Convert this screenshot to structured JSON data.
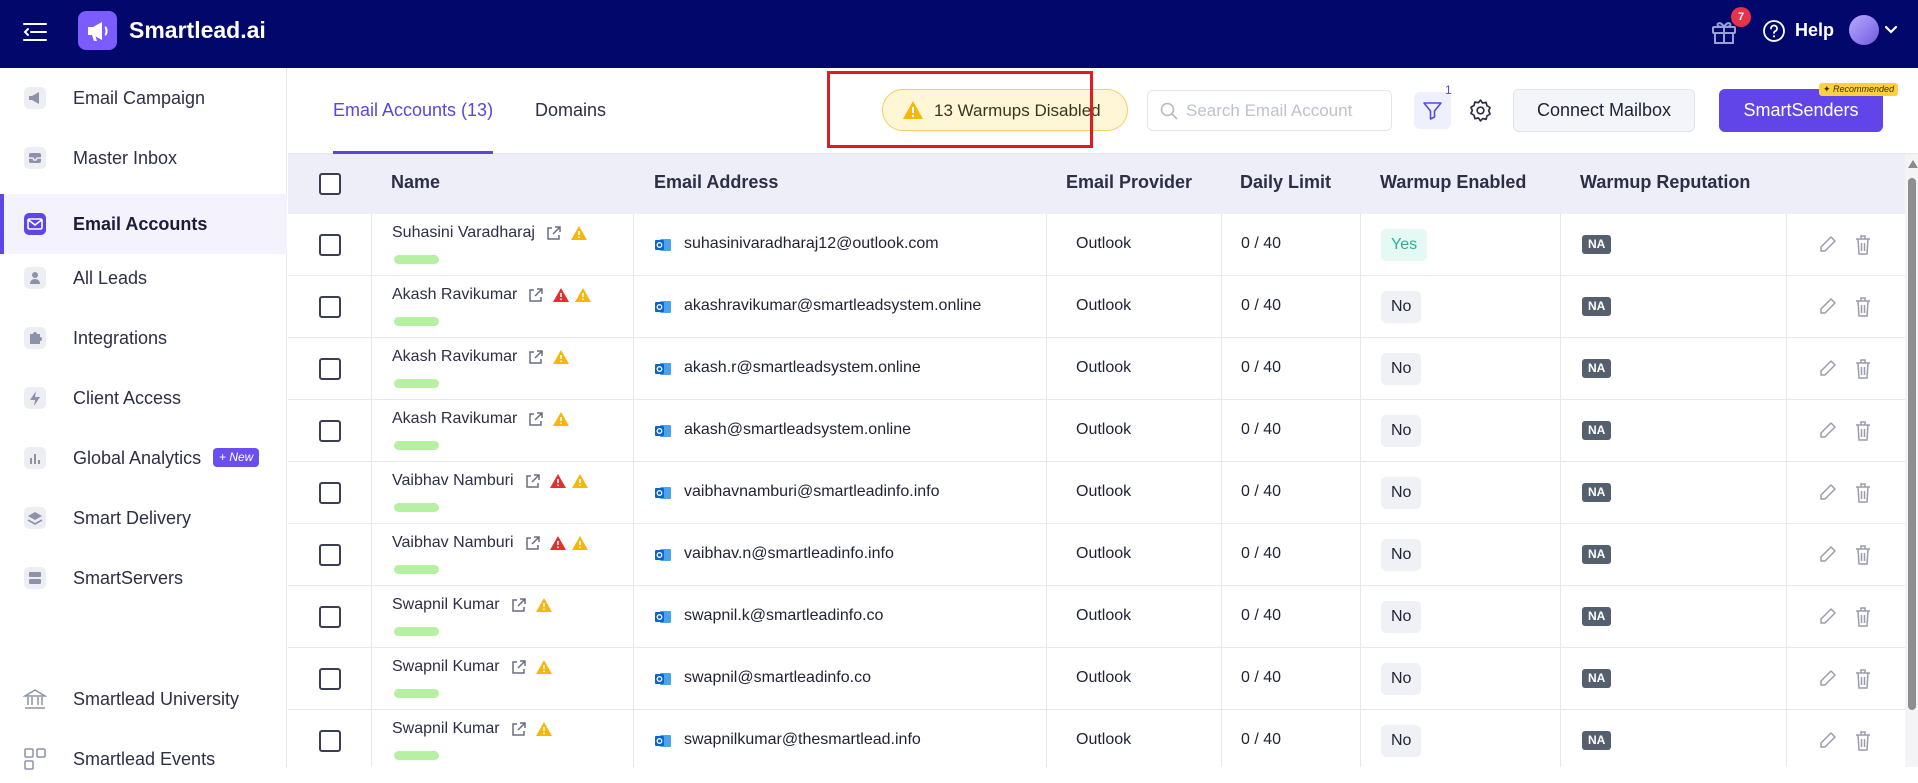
{
  "app": {
    "brand": "Smartlead.ai",
    "gift_badge": "7",
    "help_label": "Help",
    "accent_color": "#6245e8",
    "topbar_color": "#02076b"
  },
  "sidebar": {
    "items": [
      {
        "label": "Email Campaign",
        "icon": "megaphone-icon"
      },
      {
        "label": "Master Inbox",
        "icon": "inbox-icon"
      },
      {
        "label": "Email Accounts",
        "icon": "mail-icon",
        "active": true
      },
      {
        "label": "All Leads",
        "icon": "leads-icon"
      },
      {
        "label": "Integrations",
        "icon": "puzzle-icon"
      },
      {
        "label": "Client Access",
        "icon": "bolt-icon"
      },
      {
        "label": "Global Analytics",
        "icon": "bar-chart-icon",
        "badge": "+ New"
      },
      {
        "label": "Smart Delivery",
        "icon": "layers-icon"
      },
      {
        "label": "SmartServers",
        "icon": "server-icon"
      },
      {
        "label": "Smartlead University",
        "icon": "university-icon"
      },
      {
        "label": "Smartlead Events",
        "icon": "events-icon"
      }
    ]
  },
  "toolbar": {
    "tab_accounts": "Email Accounts (13)",
    "tab_domains": "Domains",
    "warmup_alert": "13 Warmups Disabled",
    "search_placeholder": "Search Email Account",
    "filter_count": "1",
    "connect_label": "Connect Mailbox",
    "smartsenders_label": "SmartSenders",
    "recommended_label": "✦ Recommended"
  },
  "table": {
    "headers": [
      "Name",
      "Email Address",
      "Email Provider",
      "Daily Limit",
      "Warmup Enabled",
      "Warmup Reputation"
    ],
    "rows": [
      {
        "name": "Suhasini Varadharaj",
        "email": "suhasinivaradharaj12@outlook.com",
        "provider": "Outlook",
        "limit": "0 / 40",
        "warmup": "Yes",
        "reputation": "NA",
        "red_alert": false
      },
      {
        "name": "Akash Ravikumar",
        "email": "akashravikumar@smartleadsystem.online",
        "provider": "Outlook",
        "limit": "0 / 40",
        "warmup": "No",
        "reputation": "NA",
        "red_alert": true
      },
      {
        "name": "Akash Ravikumar",
        "email": "akash.r@smartleadsystem.online",
        "provider": "Outlook",
        "limit": "0 / 40",
        "warmup": "No",
        "reputation": "NA",
        "red_alert": false
      },
      {
        "name": "Akash Ravikumar",
        "email": "akash@smartleadsystem.online",
        "provider": "Outlook",
        "limit": "0 / 40",
        "warmup": "No",
        "reputation": "NA",
        "red_alert": false
      },
      {
        "name": "Vaibhav Namburi",
        "email": "vaibhavnamburi@smartleadinfo.info",
        "provider": "Outlook",
        "limit": "0 / 40",
        "warmup": "No",
        "reputation": "NA",
        "red_alert": true
      },
      {
        "name": "Vaibhav Namburi",
        "email": "vaibhav.n@smartleadinfo.info",
        "provider": "Outlook",
        "limit": "0 / 40",
        "warmup": "No",
        "reputation": "NA",
        "red_alert": true
      },
      {
        "name": "Swapnil Kumar",
        "email": "swapnil.k@smartleadinfo.co",
        "provider": "Outlook",
        "limit": "0 / 40",
        "warmup": "No",
        "reputation": "NA",
        "red_alert": false
      },
      {
        "name": "Swapnil Kumar",
        "email": "swapnil@smartleadinfo.co",
        "provider": "Outlook",
        "limit": "0 / 40",
        "warmup": "No",
        "reputation": "NA",
        "red_alert": false
      },
      {
        "name": "Swapnil Kumar",
        "email": "swapnilkumar@thesmartlead.info",
        "provider": "Outlook",
        "limit": "0 / 40",
        "warmup": "No",
        "reputation": "NA",
        "red_alert": false
      }
    ]
  }
}
